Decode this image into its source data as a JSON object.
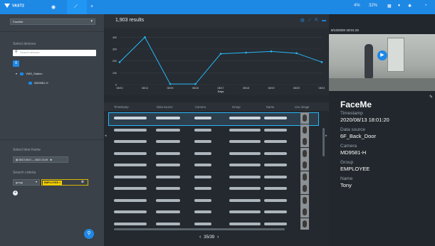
{
  "app": {
    "logo": "VAST2",
    "stats": [
      "4%",
      "32%"
    ]
  },
  "filter": {
    "selected": "FaceMe"
  },
  "devices": {
    "title": "Select devices",
    "search_placeholder": "Search devices",
    "tree": {
      "station": "VMS_Station",
      "camera": "MD9581-H"
    }
  },
  "time": {
    "title": "Select time frame",
    "range": "08/13 06:01 — 08/21 15:49"
  },
  "criteria": {
    "title": "Search criteria",
    "field": "group",
    "tag": "EMPLOYEE"
  },
  "results": {
    "count": "1,903 results"
  },
  "chart_data": {
    "type": "line",
    "categories": [
      "08/13",
      "08/14",
      "08/15",
      "08/16",
      "08/17",
      "08/18",
      "08/19",
      "08/20",
      "08/21"
    ],
    "values": [
      190,
      400,
      5,
      5,
      260,
      270,
      280,
      265,
      190
    ],
    "xlabel": "Days",
    "ylabel": "",
    "yticks": [
      0,
      100,
      200,
      300,
      400
    ],
    "ylim": [
      0,
      420
    ],
    "grid": true,
    "line_color": "#29b6f6"
  },
  "table": {
    "columns": [
      "Timestamp",
      "Data source",
      "Camera",
      "Group",
      "Name",
      "Live image"
    ],
    "row_count": 10,
    "selected_row": 0
  },
  "pager": {
    "page": "35/39"
  },
  "detail": {
    "video_timestamp": "8/13/2020 18:01:19",
    "title": "FaceMe",
    "fields": [
      {
        "label": "Timestamp",
        "value": "2020/08/13 18:01:20"
      },
      {
        "label": "Data source",
        "value": "6F_Back_Door"
      },
      {
        "label": "Camera",
        "value": "MD9581-H"
      },
      {
        "label": "Group",
        "value": "EMPLOYEE"
      },
      {
        "label": "Name",
        "value": "Tony"
      }
    ]
  },
  "colors": {
    "accent": "#1e88e5",
    "selection": "#29b6f6",
    "tag": "#f5d000"
  }
}
